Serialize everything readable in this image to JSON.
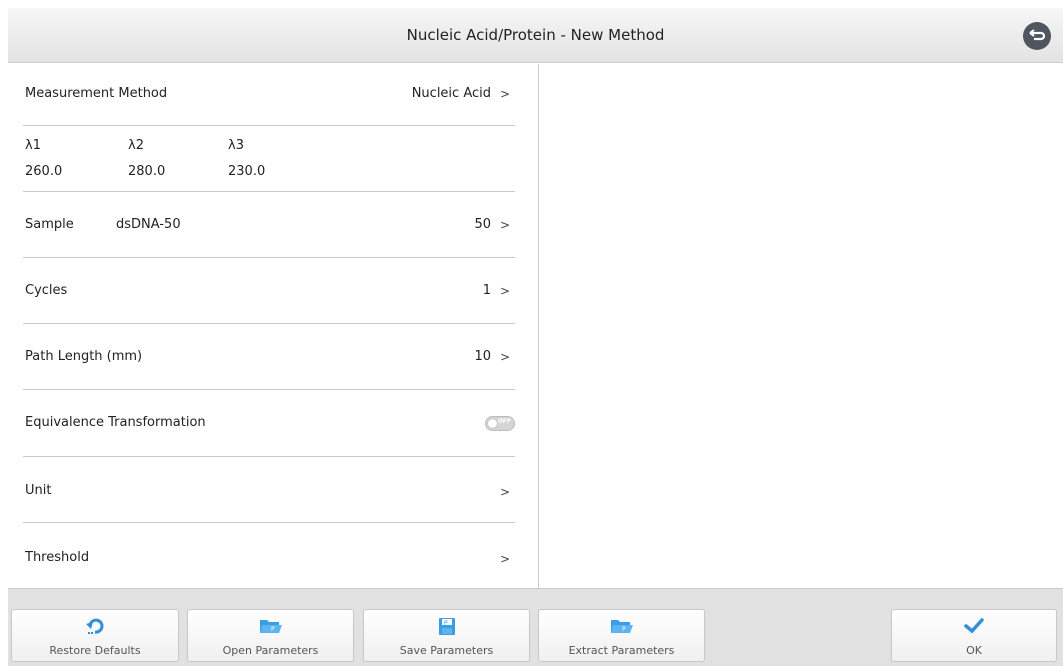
{
  "window": {
    "title": "Nucleic Acid/Protein - New Method"
  },
  "settings": {
    "measurement_method": {
      "label": "Measurement Method",
      "value": "Nucleic Acid",
      "chevron": ">"
    },
    "wavelengths": {
      "headers": [
        "λ1",
        "λ2",
        "λ3"
      ],
      "values": [
        "260.0",
        "280.0",
        "230.0"
      ]
    },
    "sample": {
      "label": "Sample",
      "name": "dsDNA-50",
      "value": "50",
      "chevron": ">"
    },
    "cycles": {
      "label": "Cycles",
      "value": "1",
      "chevron": ">"
    },
    "path_length": {
      "label": "Path Length (mm)",
      "value": "10",
      "chevron": ">"
    },
    "equivalence": {
      "label": "Equivalence Transformation",
      "toggle_state": "OFF"
    },
    "unit": {
      "label": "Unit",
      "chevron": ">"
    },
    "threshold": {
      "label": "Threshold",
      "chevron": ">"
    }
  },
  "footer": {
    "restore": "Restore Defaults",
    "open": "Open Parameters",
    "save": "Save Parameters",
    "extract": "Extract Parameters",
    "ok": "OK"
  },
  "colors": {
    "accent": "#2f8fd8",
    "title_bg": "#e8e8e8",
    "footer_bg": "#e1e1e1"
  }
}
